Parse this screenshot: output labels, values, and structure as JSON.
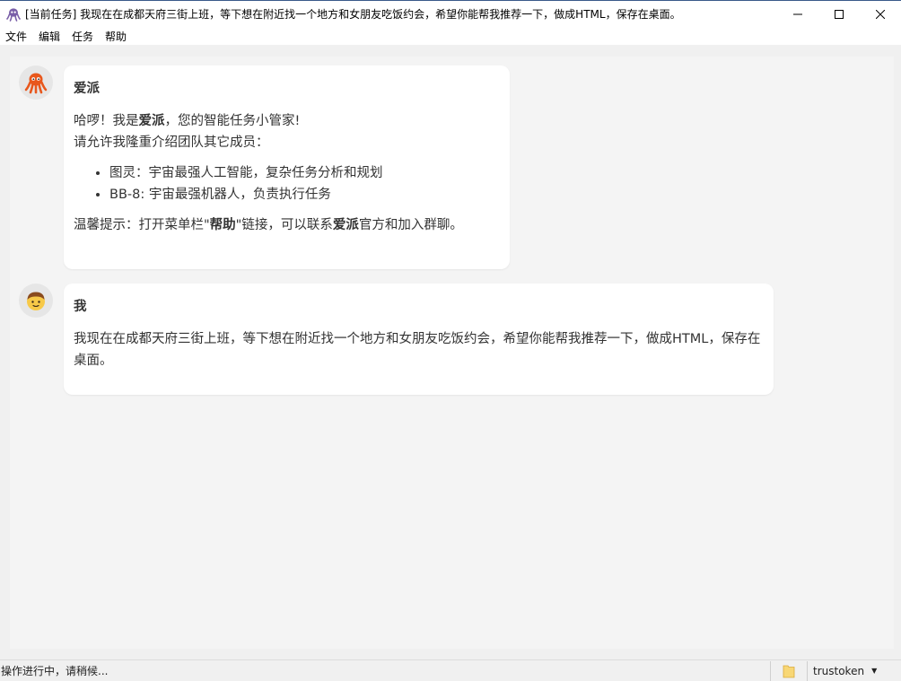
{
  "window": {
    "title": "[当前任务] 我现在在成都天府三街上班，等下想在附近找一个地方和女朋友吃饭约会，希望你能帮我推荐一下，做成HTML，保存在桌面。",
    "app_icon": "octopus-icon"
  },
  "menu": {
    "items": [
      "文件",
      "编辑",
      "任务",
      "帮助"
    ]
  },
  "messages": {
    "assistant": {
      "sender": "爱派",
      "avatar_icon": "octopus-icon",
      "greeting_pre": "哈啰！我是",
      "greeting_name": "爱派",
      "greeting_post": "，您的智能任务小管家!",
      "intro": "请允许我隆重介绍团队其它成员：",
      "members": [
        "图灵：宇宙最强人工智能，复杂任务分析和规划",
        "BB-8: 宇宙最强机器人，负责执行任务"
      ],
      "tip_pre": "温馨提示：打开菜单栏\"",
      "tip_link": "帮助",
      "tip_mid": "\"链接，可以联系",
      "tip_name": "爱派",
      "tip_post": "官方和加入群聊。"
    },
    "user": {
      "sender": "我",
      "avatar_icon": "boy-face-icon",
      "text": "我现在在成都天府三街上班，等下想在附近找一个地方和女朋友吃饭约会，希望你能帮我推荐一下，做成HTML，保存在桌面。"
    }
  },
  "statusbar": {
    "status": "操作进行中，请稍候...",
    "folder_icon": "folder-icon",
    "user": "trustoken"
  },
  "colors": {
    "accent_octopus": "#e8571c",
    "chat_bg": "#f4f4f4",
    "bubble_bg": "#ffffff"
  }
}
